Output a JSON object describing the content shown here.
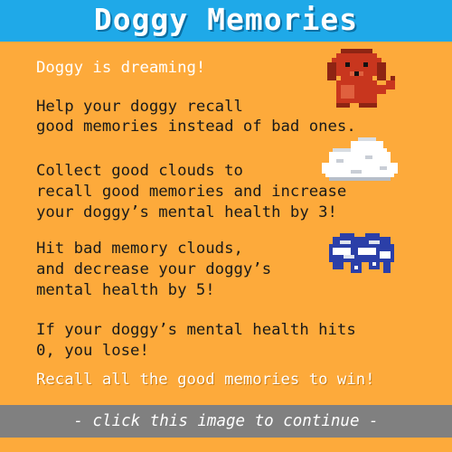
{
  "header": {
    "title": "Doggy Memories"
  },
  "instructions": {
    "dreaming": "Doggy is dreaming!",
    "help_line1": "Help your doggy recall",
    "help_line2": "good memories instead of bad ones.",
    "good_line1": "Collect good clouds to",
    "good_line2": "recall good memories and increase",
    "good_line3": "your doggy’s mental health by 3!",
    "bad_line1": "Hit bad memory clouds,",
    "bad_line2": "and decrease your doggy’s",
    "bad_line3": "mental health by 5!",
    "lose_line1": "If your doggy’s mental health hits",
    "lose_line2": "0, you lose!",
    "win": "Recall all the good memories to win!"
  },
  "footer": {
    "continue_text": "- click this image to continue -"
  },
  "colors": {
    "background": "#FDAA3B",
    "title_bar": "#1FA9E8",
    "footer_bar": "#808080",
    "dog": "#C8361E",
    "good_cloud": "#FFFFFF",
    "bad_cloud": "#2B3FA8"
  },
  "icons": {
    "dog": "pixel-dog-icon",
    "good_cloud": "good-cloud-icon",
    "bad_cloud": "bad-cloud-icon"
  }
}
